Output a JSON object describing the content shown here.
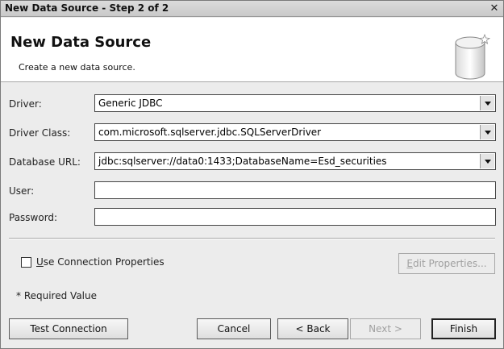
{
  "window": {
    "title": "New Data Source - Step 2 of 2",
    "close_glyph": "✕"
  },
  "banner": {
    "heading": "New Data Source",
    "subheading": "Create a new data source.",
    "icon": "database-icon"
  },
  "form": {
    "driver": {
      "label": "Driver:",
      "value": "Generic JDBC"
    },
    "driver_class": {
      "label": "Driver Class:",
      "value": "com.microsoft.sqlserver.jdbc.SQLServerDriver"
    },
    "database_url": {
      "label": "Database URL:",
      "value": "jdbc:sqlserver://data0:1433;DatabaseName=Esd_securities"
    },
    "user": {
      "label": "User:",
      "value": ""
    },
    "password": {
      "label": "Password:",
      "value": ""
    }
  },
  "options": {
    "use_connection_properties": {
      "mnemonic": "U",
      "label_rest": "se Connection Properties",
      "checked": false
    },
    "edit_properties": {
      "mnemonic": "E",
      "label_rest": "dit Properties...",
      "enabled": false
    },
    "required_note": "* Required Value"
  },
  "buttons": {
    "test_connection": "Test Connection",
    "cancel": "Cancel",
    "back": "< Back",
    "next": "Next >",
    "finish": "Finish"
  }
}
